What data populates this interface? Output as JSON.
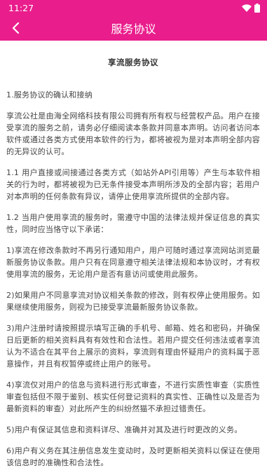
{
  "status_bar": {
    "time": "11:27"
  },
  "app_bar": {
    "title": "服务协议",
    "background": "#e91e8c"
  },
  "document": {
    "title": "享流服务协议",
    "paragraphs": [
      "1.服务协议的确认和接纳",
      "享流公社是由海全网络科技有限公司拥有所有权与经营权产品。用户在接受享流的服务之前，请务必仔细阅读本条款并同意本声明。访问者访问本软件或通过各类方式使用本软件的行为，都将被视为是对本声明全部内容的无异议的认可。",
      "1.1 用户直接或间接通过各类方式（如站外API引用等）产生与本软件相关的行为时，都将被视为已无条件接受本声明所涉及的全部内容；若用户对本声明的任何条款有异议，请停止使用享流所提供的全部内容。",
      "1.2 当用户使用享流的服务时，需遵守中国的法律法规并保证信息的真实性，同时应当恪守以下承诺：",
      "1)享流在修改条款时不再另行通知用户，用户可随时通过享流网站浏览最新服务协议条款。用户只有在同意遵守相关法律法规和本协议时，才有权使用享流的服务，无论用户是否有意访问或使用此服务。",
      "2)如果用户不同意享流对协议相关条款的修改，则有权停止使用服务。如果继续使用服务，则视为已接受享流最新服务协议条款。",
      "3)用户注册时请按照提示填写正确的手机号、邮箱、姓名和密码，并确保日后更新的相关资料具有有效性和合法性。若用户提交任何违法或者享流认为不适合在其平台上展示的资料，享流则有理由怀疑用户的资料属于恶意操作，并且有权暂停或终止用户的账号。",
      "4)享流仅对用户的信息与资料进行形式审查，不进行实质性审查（实质性审查包括但不限于鉴别、核实任何登记资料的真实性、正确性以及是否为最新资料的审查）对此所产生的纠纷然猫不承担过错责任。",
      "5)用户有保证其信息和资料详尽、准确并对其及进行时更改的义务。",
      "6)用户有义务在其注册信息发生变动时，及时更新相关资料以保证在使用该信息时的准确性和合法性。"
    ]
  }
}
